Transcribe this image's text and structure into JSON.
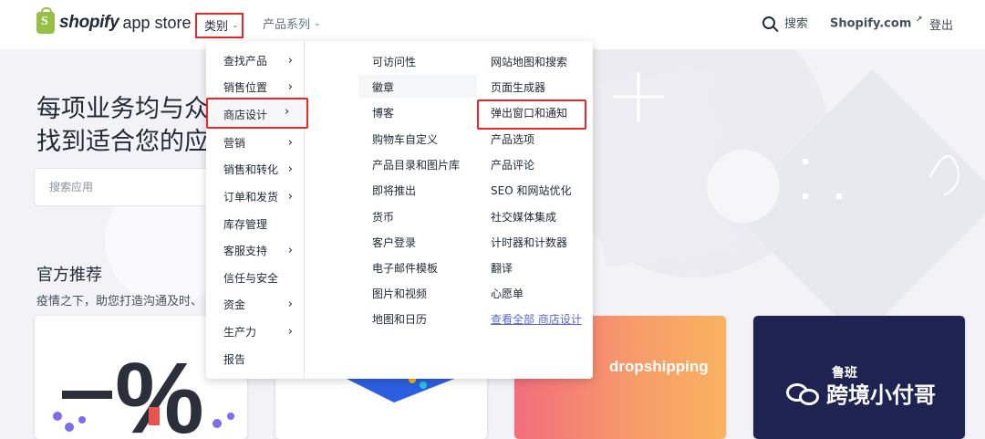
{
  "header": {
    "logo_word": "shopify",
    "logo_sub": "app store",
    "nav_category": "类别",
    "nav_series": "产品系列",
    "search_label": "搜索",
    "shopify_link": "Shopify.com",
    "shopify_link_ext": "↗",
    "logout": "登出"
  },
  "hero": {
    "title_line1": "每项业务均与众",
    "title_line2": "找到适合您的应",
    "search_placeholder": "搜索应用",
    "recommend_title": "官方推荐",
    "recommend_subtitle": "疫情之下，助您打造沟通及时、"
  },
  "dropdown": {
    "categories": [
      {
        "label": "查找产品",
        "arrow": "›"
      },
      {
        "label": "销售位置",
        "arrow": "›"
      },
      {
        "label": "商店设计",
        "arrow": "›",
        "active": true
      },
      {
        "label": "营销",
        "arrow": "›"
      },
      {
        "label": "销售和转化",
        "arrow": "›"
      },
      {
        "label": "订单和发货",
        "arrow": "›"
      },
      {
        "label": "库存管理",
        "arrow": ""
      },
      {
        "label": "客服支持",
        "arrow": "›"
      },
      {
        "label": "信任与安全",
        "arrow": ""
      },
      {
        "label": "资金",
        "arrow": "›"
      },
      {
        "label": "生产力",
        "arrow": "›"
      },
      {
        "label": "报告",
        "arrow": ""
      }
    ],
    "col1": [
      "可访问性",
      "徽章",
      "博客",
      "购物车自定义",
      "产品目录和图片库",
      "即将推出",
      "货币",
      "客户登录",
      "电子邮件模板",
      "图片和视频",
      "地图和日历"
    ],
    "col2": [
      "网站地图和搜索",
      "页面生成器",
      "弹出窗口和通知",
      "产品选项",
      "产品评论",
      "SEO 和网站优化",
      "社交媒体集成",
      "计时器和计数器",
      "翻译",
      "心愿单",
      "查看全部 商店设计"
    ]
  },
  "cards": {
    "card3_text": "dropshipping"
  },
  "watermark": {
    "name": "跨境小付哥",
    "small": "鲁班"
  },
  "colors": {
    "accent_red": "#e8272a",
    "link": "#5c6ac4",
    "brand_green": "#95bf47"
  }
}
